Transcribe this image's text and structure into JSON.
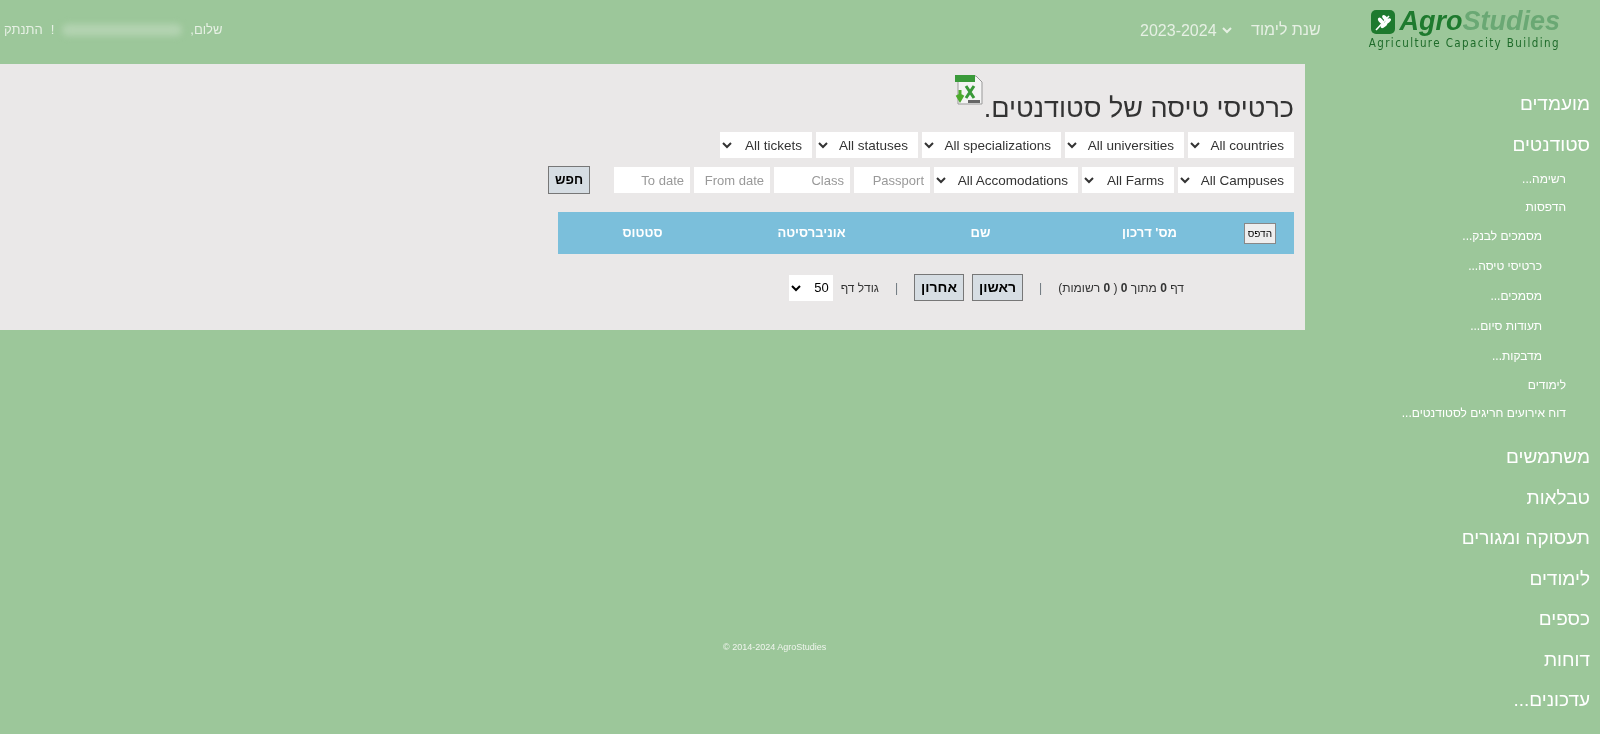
{
  "header": {
    "logo": {
      "brand_bold": "Agro",
      "brand_light": "Studies",
      "tagline": "Agriculture Capacity Building"
    },
    "year_label": "שנת לימוד",
    "year_value": "2023-2024",
    "greeting": "שלום,",
    "greeting_end": "!",
    "logout": "התנתק"
  },
  "sidebar": {
    "items": [
      {
        "label": "מועמדים"
      },
      {
        "label": "סטודנטים",
        "children": [
          {
            "label": "רשימה..."
          },
          {
            "label": "הדפסות",
            "children": [
              {
                "label": "מסמכים לבנק..."
              },
              {
                "label": "כרטיסי טיסה..."
              },
              {
                "label": "מסמכים..."
              },
              {
                "label": "תעודות סיום..."
              },
              {
                "label": "מדבקות..."
              }
            ]
          },
          {
            "label": "לימודים"
          },
          {
            "label": "דוח אירועים חריגים לסטודנטים..."
          }
        ]
      },
      {
        "label": "משתמשים"
      },
      {
        "label": "טבלאות"
      },
      {
        "label": "תעסוקה ומגורים"
      },
      {
        "label": "לימודים"
      },
      {
        "label": "כספים"
      },
      {
        "label": "דוחות"
      },
      {
        "label": "עדכונים..."
      }
    ]
  },
  "page": {
    "title": "כרטיסי טיסה של סטודנטים.",
    "filter_rows": [
      [
        {
          "kind": "select",
          "value": "All countries"
        },
        {
          "kind": "select",
          "value": "All universities"
        },
        {
          "kind": "select",
          "value": "All specializations"
        },
        {
          "kind": "select",
          "value": "All statuses"
        },
        {
          "kind": "select",
          "value": "All tickets"
        }
      ],
      [
        {
          "kind": "select",
          "value": "All Campuses"
        },
        {
          "kind": "select",
          "value": "All Farms"
        },
        {
          "kind": "select",
          "value": "All Accomodations"
        },
        {
          "kind": "input",
          "placeholder": "Passport"
        },
        {
          "kind": "input",
          "placeholder": "Class"
        },
        {
          "kind": "input",
          "placeholder": "From date"
        },
        {
          "kind": "input",
          "placeholder": "To date"
        },
        {
          "kind": "button",
          "label": "חפש"
        }
      ]
    ],
    "table": {
      "print_button": "הדפס",
      "columns": [
        "מס' דרכון",
        "שם",
        "אוניברסיטה",
        "סטטוס"
      ]
    },
    "pager": {
      "summary": "דף **0** מתוך **0** ( **0** רשומות)",
      "divider": "|",
      "first": "ראשון",
      "last": "אחרון",
      "divider_2": "|",
      "page_size_label": "גודל דף",
      "page_size": "50"
    }
  },
  "footer": "© 2014-2024 AgroStudies"
}
